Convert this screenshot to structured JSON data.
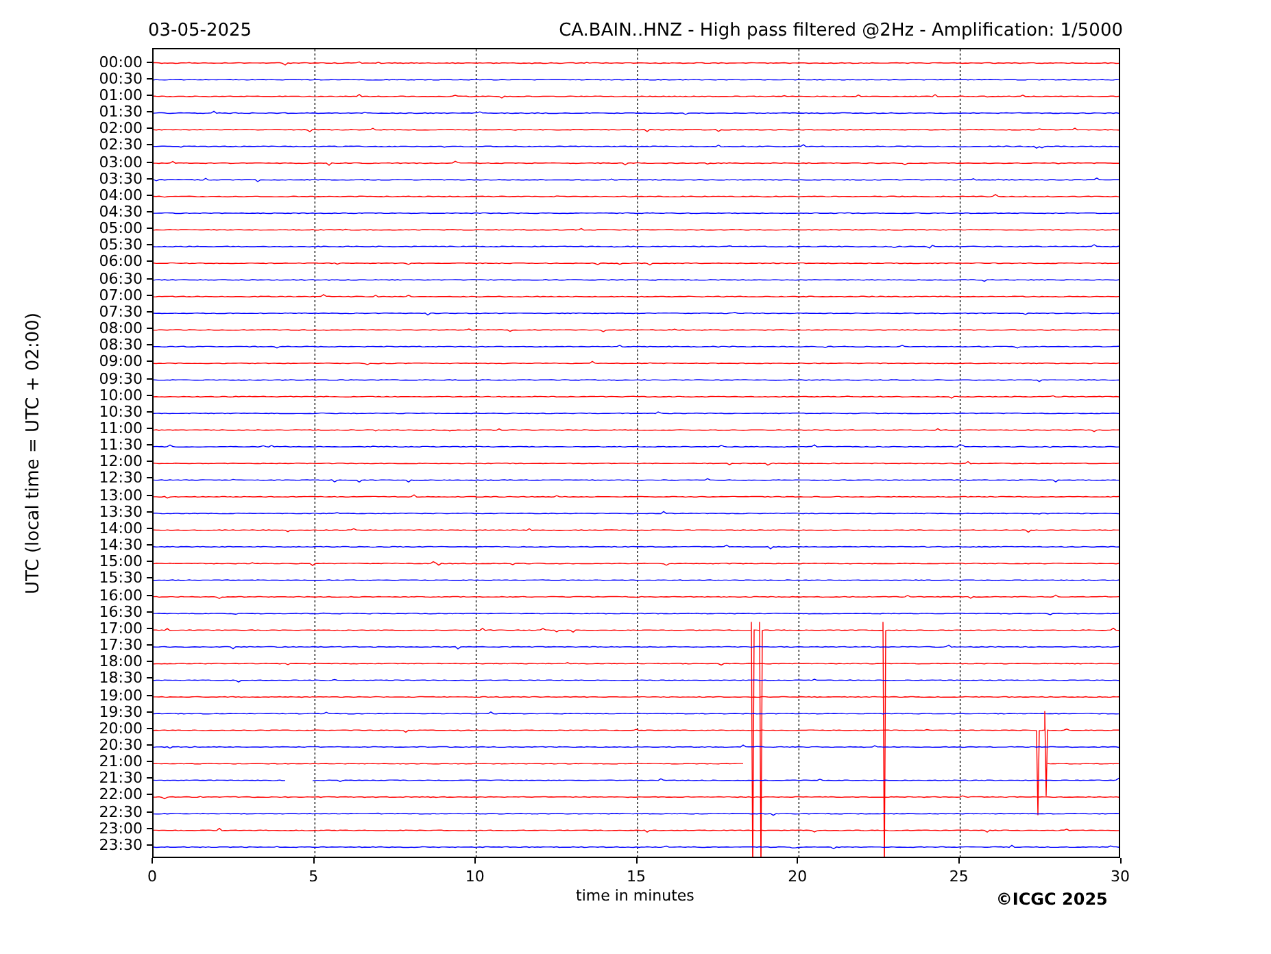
{
  "header": {
    "date": "03-05-2025",
    "title": "CA.BAIN..HNZ - High pass filtered @2Hz - Amplification: 1/5000"
  },
  "y_axis": {
    "label": "UTC (local time = UTC + 02:00)"
  },
  "rows": [
    {
      "label": "00:00",
      "color": "#ff0000"
    },
    {
      "label": "00:30",
      "color": "#0000ff"
    },
    {
      "label": "01:00",
      "color": "#ff0000"
    },
    {
      "label": "01:30",
      "color": "#0000ff"
    },
    {
      "label": "02:00",
      "color": "#ff0000"
    },
    {
      "label": "02:30",
      "color": "#0000ff"
    },
    {
      "label": "03:00",
      "color": "#ff0000"
    },
    {
      "label": "03:30",
      "color": "#0000ff"
    },
    {
      "label": "04:00",
      "color": "#ff0000"
    },
    {
      "label": "04:30",
      "color": "#0000ff"
    },
    {
      "label": "05:00",
      "color": "#ff0000"
    },
    {
      "label": "05:30",
      "color": "#0000ff"
    },
    {
      "label": "06:00",
      "color": "#ff0000"
    },
    {
      "label": "06:30",
      "color": "#0000ff"
    },
    {
      "label": "07:00",
      "color": "#ff0000"
    },
    {
      "label": "07:30",
      "color": "#0000ff"
    },
    {
      "label": "08:00",
      "color": "#ff0000"
    },
    {
      "label": "08:30",
      "color": "#0000ff"
    },
    {
      "label": "09:00",
      "color": "#ff0000"
    },
    {
      "label": "09:30",
      "color": "#0000ff"
    },
    {
      "label": "10:00",
      "color": "#ff0000"
    },
    {
      "label": "10:30",
      "color": "#0000ff"
    },
    {
      "label": "11:00",
      "color": "#ff0000"
    },
    {
      "label": "11:30",
      "color": "#0000ff"
    },
    {
      "label": "12:00",
      "color": "#ff0000"
    },
    {
      "label": "12:30",
      "color": "#0000ff"
    },
    {
      "label": "13:00",
      "color": "#ff0000"
    },
    {
      "label": "13:30",
      "color": "#0000ff"
    },
    {
      "label": "14:00",
      "color": "#ff0000"
    },
    {
      "label": "14:30",
      "color": "#0000ff"
    },
    {
      "label": "15:00",
      "color": "#ff0000"
    },
    {
      "label": "15:30",
      "color": "#0000ff"
    },
    {
      "label": "16:00",
      "color": "#ff0000"
    },
    {
      "label": "16:30",
      "color": "#0000ff"
    },
    {
      "label": "17:00",
      "color": "#ff0000"
    },
    {
      "label": "17:30",
      "color": "#0000ff"
    },
    {
      "label": "18:00",
      "color": "#ff0000"
    },
    {
      "label": "18:30",
      "color": "#0000ff"
    },
    {
      "label": "19:00",
      "color": "#ff0000"
    },
    {
      "label": "19:30",
      "color": "#0000ff"
    },
    {
      "label": "20:00",
      "color": "#ff0000"
    },
    {
      "label": "20:30",
      "color": "#0000ff"
    },
    {
      "label": "21:00",
      "color": "#ff0000"
    },
    {
      "label": "21:30",
      "color": "#0000ff"
    },
    {
      "label": "22:00",
      "color": "#ff0000"
    },
    {
      "label": "22:30",
      "color": "#0000ff"
    },
    {
      "label": "23:00",
      "color": "#ff0000"
    },
    {
      "label": "23:30",
      "color": "#0000ff"
    }
  ],
  "x_axis": {
    "label": "time in minutes",
    "ticks": [
      "0",
      "5",
      "10",
      "15",
      "20",
      "25",
      "30"
    ]
  },
  "copyright": "©ICGC 2025"
}
